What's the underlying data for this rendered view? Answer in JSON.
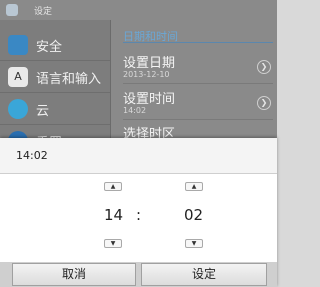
{
  "statusbar": {
    "title": "设定"
  },
  "sidebar": {
    "items": [
      {
        "label": "安全",
        "icon": "lock-icon",
        "color": "#3a88c4"
      },
      {
        "label": "语言和输入",
        "icon": "keyboard-a-icon",
        "color": "#e9e9e9"
      },
      {
        "label": "云",
        "icon": "cloud-icon",
        "color": "#3aa6d8"
      },
      {
        "label": "重置",
        "icon": "reset-icon",
        "color": "#2a6fb0"
      }
    ]
  },
  "detail": {
    "section_title": "日期和时间",
    "items": [
      {
        "title": "设置日期",
        "subtitle": "2013-12-10"
      },
      {
        "title": "设置时间",
        "subtitle": "14:02"
      },
      {
        "title": "选择时区",
        "subtitle": ""
      }
    ]
  },
  "dialog": {
    "title": "14:02",
    "hour": "14",
    "separator": ":",
    "minute": "02",
    "up_glyph": "▲",
    "down_glyph": "▼",
    "cancel_label": "取消",
    "set_label": "设定"
  }
}
